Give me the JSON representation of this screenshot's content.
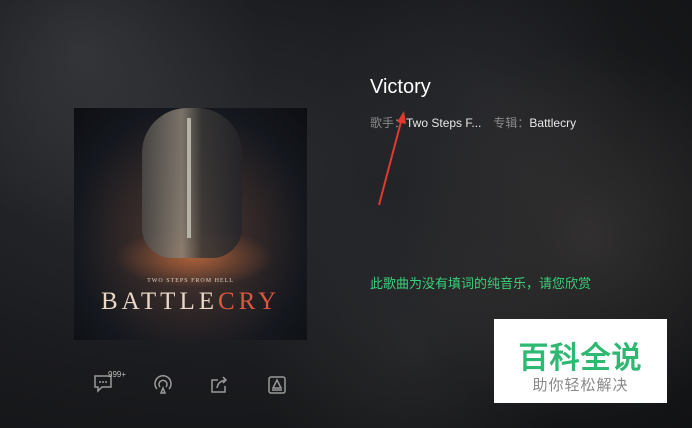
{
  "song": {
    "title": "Victory",
    "artist_label": "歌手：",
    "artist": "Two Steps F...",
    "album_label": "专辑：",
    "album": "Battlecry",
    "notice": "此歌曲为没有填词的纯音乐，请您欣赏"
  },
  "cover": {
    "subtitle": "TWO STEPS FROM HELL",
    "title_part1": "BATTLE",
    "title_part2": "CRY"
  },
  "actions": {
    "comment_count": "999+",
    "icons": [
      "comment-icon",
      "radio-icon",
      "share-icon",
      "download-icon"
    ]
  },
  "watermark": {
    "title": "百科全说",
    "subtitle": "助你轻松解决"
  },
  "colors": {
    "accent_green": "#3bd07a",
    "watermark_green": "#2eb872",
    "arrow_red": "#e03a2e"
  }
}
